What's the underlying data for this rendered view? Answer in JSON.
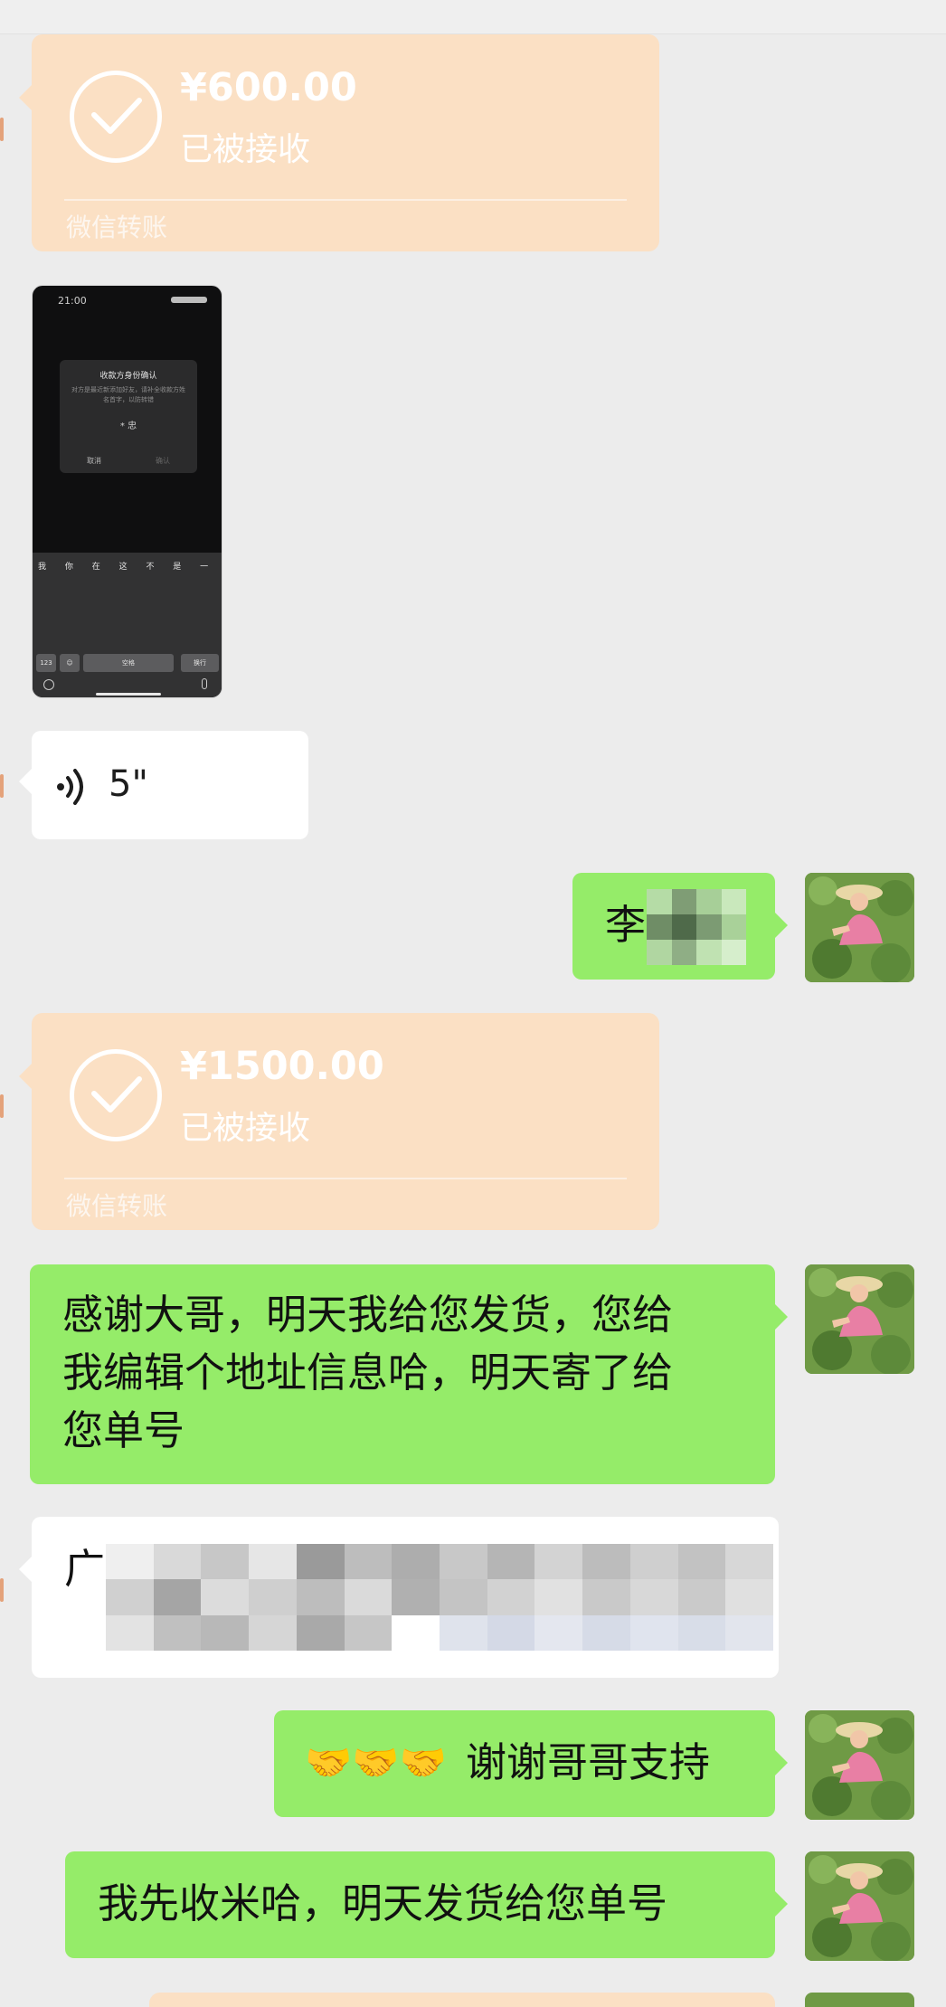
{
  "colors": {
    "background": "#ececec",
    "sent_bubble": "#95ec69",
    "received_bubble": "#ffffff",
    "transfer_card": "#fbe0c4"
  },
  "messages": {
    "transfer_1": {
      "amount": "¥600.00",
      "status": "已被接收",
      "label": "微信转账",
      "icon": "check-circle-icon"
    },
    "image_1": {
      "time": "21:00",
      "dialog_title": "收款方身份确认",
      "dialog_body": "对方是最近新添加好友，请补全收款方姓名首字，以防转错",
      "dialog_name": "* 忠",
      "cancel": "取消",
      "confirm": "确认",
      "candidates": "我 你 在 这 不 是 一 好 他 有",
      "key_123": "123",
      "key_space": "空格",
      "key_enter": "换行"
    },
    "voice_1": {
      "duration": "5\"",
      "icon": "voice-wave-icon"
    },
    "sent_name": {
      "text": "李"
    },
    "transfer_2": {
      "amount": "¥1500.00",
      "status": "已被接收",
      "label": "微信转账",
      "icon": "check-circle-icon"
    },
    "sent_thanks": {
      "line1": "感谢大哥，明天我给您发货，您给",
      "line2": "我编辑个地址信息哈，明天寄了给",
      "line3": "您单号"
    },
    "received_address": {
      "text": "广东"
    },
    "sent_support": {
      "emoji": "🤝🤝🤝",
      "text": "谢谢哥哥支持"
    },
    "sent_receipt": {
      "text": "我先收米哈，明天发货给您单号"
    }
  },
  "avatar": {
    "icon": "avatar-tea-farmer-icon"
  }
}
